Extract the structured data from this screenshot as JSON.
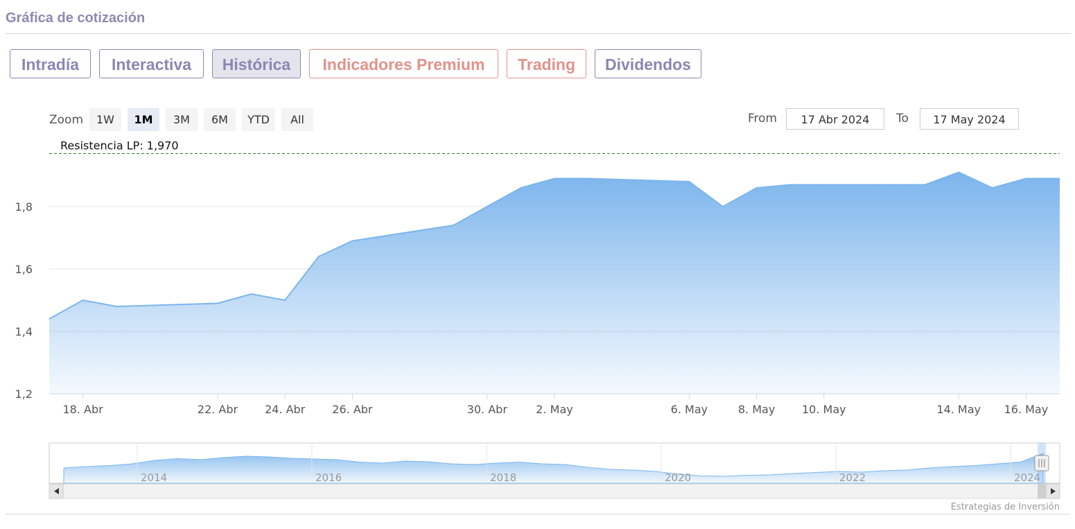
{
  "title": "Gráfica de cotización",
  "tabs": [
    {
      "label": "Intradía",
      "color": "#8a86b3",
      "active": false
    },
    {
      "label": "Interactiva",
      "color": "#8a86b3",
      "active": false
    },
    {
      "label": "Histórica",
      "color": "#8a86b3",
      "active": true
    },
    {
      "label": "Indicadores Premium",
      "color": "#e1938a",
      "active": false
    },
    {
      "label": "Trading",
      "color": "#e1938a",
      "active": false
    },
    {
      "label": "Dividendos",
      "color": "#8a86b3",
      "active": false
    }
  ],
  "zoom": {
    "label": "Zoom",
    "options": [
      "1W",
      "1M",
      "3M",
      "6M",
      "YTD",
      "All"
    ],
    "selected": "1M"
  },
  "range": {
    "from_label": "From",
    "from_value": "17 Abr 2024",
    "to_label": "To",
    "to_value": "17 May 2024"
  },
  "credit": "Estrategias de Inversión",
  "colors": {
    "area_line": "#7cb5ec",
    "area_fill_top": "#7cb5ec",
    "resistance_line": "#2e7d32"
  },
  "chart_data": {
    "type": "area",
    "title": "",
    "xlabel": "",
    "ylabel": "",
    "ylim": [
      1.2,
      2.0
    ],
    "y_ticks": [
      "1,2",
      "1,4",
      "1,6",
      "1,8"
    ],
    "y_tick_values": [
      1.2,
      1.4,
      1.6,
      1.8
    ],
    "x_ticks": [
      "18. Abr",
      "22. Abr",
      "24. Abr",
      "26. Abr",
      "30. Abr",
      "2. May",
      "6. May",
      "8. May",
      "10. May",
      "14. May",
      "16. May"
    ],
    "x_tick_dates": [
      "2024-04-18",
      "2024-04-22",
      "2024-04-24",
      "2024-04-26",
      "2024-04-30",
      "2024-05-02",
      "2024-05-06",
      "2024-05-08",
      "2024-05-10",
      "2024-05-14",
      "2024-05-16"
    ],
    "grid": true,
    "legend": "none",
    "series": [
      {
        "x": [
          "2024-04-17",
          "2024-04-18",
          "2024-04-19",
          "2024-04-22",
          "2024-04-23",
          "2024-04-24",
          "2024-04-25",
          "2024-04-26",
          "2024-04-29",
          "2024-04-30",
          "2024-05-01",
          "2024-05-02",
          "2024-05-03",
          "2024-05-06",
          "2024-05-07",
          "2024-05-08",
          "2024-05-09",
          "2024-05-10",
          "2024-05-13",
          "2024-05-14",
          "2024-05-15",
          "2024-05-16",
          "2024-05-17"
        ],
        "values": [
          1.44,
          1.5,
          1.48,
          1.49,
          1.52,
          1.5,
          1.64,
          1.69,
          1.74,
          1.8,
          1.86,
          1.89,
          1.89,
          1.88,
          1.8,
          1.86,
          1.87,
          1.87,
          1.87,
          1.91,
          1.86,
          1.89,
          1.89
        ]
      }
    ],
    "plot_x": [
      0.0,
      0.048,
      0.095,
      0.143,
      0.19,
      0.238,
      0.286,
      0.333,
      0.381,
      0.429,
      0.476,
      0.524,
      0.571,
      0.619,
      0.667,
      0.714,
      0.762,
      0.81,
      0.857,
      0.905,
      0.952,
      1.0
    ],
    "annotations": [
      {
        "label": "Resistencia LP: 1,970",
        "value": 1.97,
        "style": "dashed"
      }
    ],
    "navigator": {
      "year_labels": [
        "2014",
        "2016",
        "2018",
        "2020",
        "2022",
        "2024"
      ]
    }
  }
}
